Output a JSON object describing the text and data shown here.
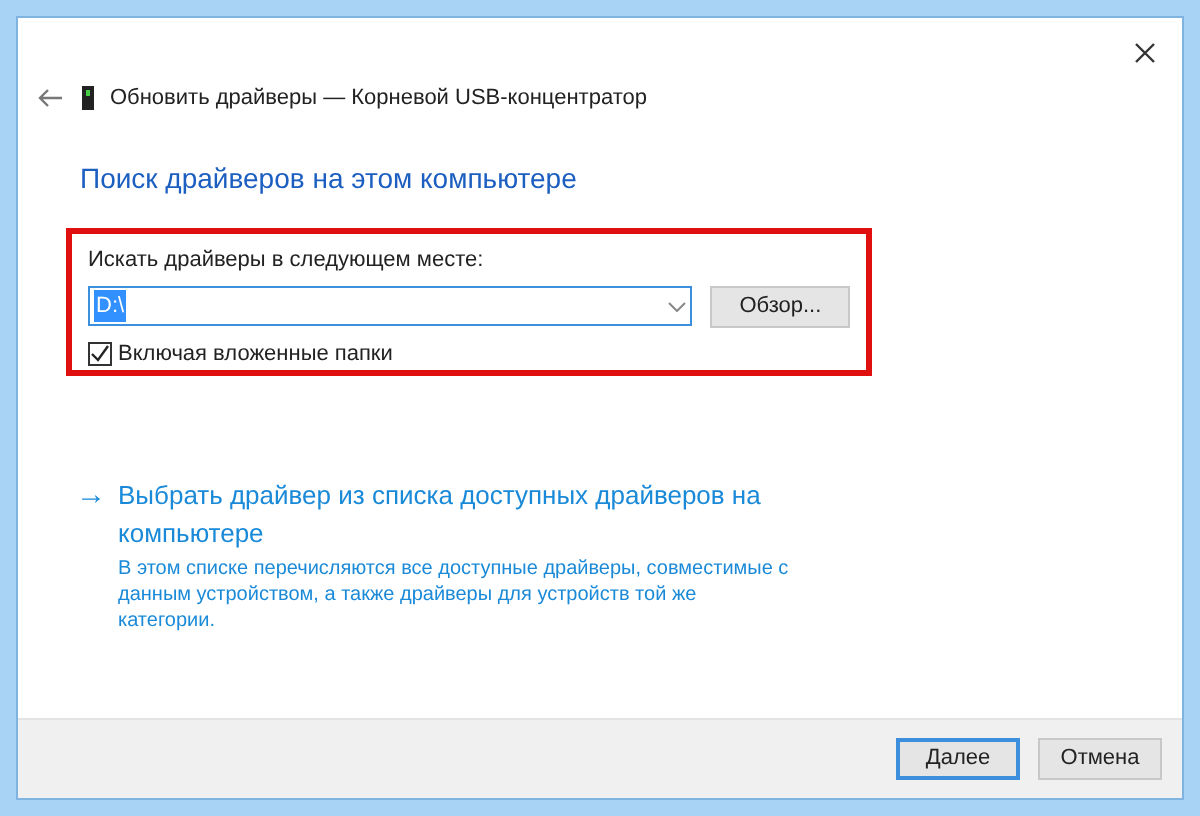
{
  "window": {
    "title": "Обновить драйверы — Корневой USB-концентратор"
  },
  "heading": "Поиск драйверов на этом компьютере",
  "search_location": {
    "label": "Искать драйверы в следующем месте:",
    "path_field": {
      "value": "D:\\",
      "selected": true
    },
    "browse_button": "Обзор...",
    "include_subfolders": {
      "label": "Включая вложенные папки",
      "checked": true
    }
  },
  "pick_option": {
    "arrow": "→",
    "title": "Выбрать драйвер из списка доступных драйверов на компьютере",
    "description": "В этом списке перечисляются все доступные драйверы, совместимые с данным устройством, а также драйверы для устройств той же категории."
  },
  "buttons": [
    {
      "label": "Далее",
      "selected": true
    },
    {
      "label": "Отмена",
      "selected": false
    }
  ]
}
